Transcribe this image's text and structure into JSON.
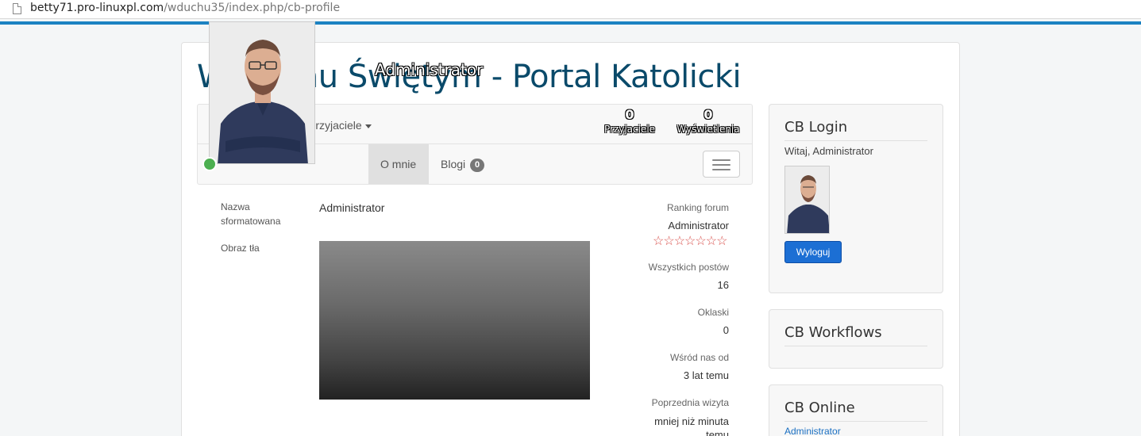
{
  "browser": {
    "url_host": "betty71.pro-linuxpl.com",
    "url_path": "/wduchu35/index.php/cb-profile"
  },
  "site": {
    "title": "W Duchu Świętym - Portal Katolicki"
  },
  "profile": {
    "display_name_overlay": "Administrator",
    "friends_menu_label": "Przyjaciele",
    "stats": {
      "friends_count": "0",
      "friends_label": "Przyjaciele",
      "views_count": "0",
      "views_label": "Wyświetlenia"
    },
    "tabs": [
      {
        "label": "O mnie"
      },
      {
        "label": "Blogi",
        "badge": "0"
      }
    ],
    "online": true
  },
  "details": {
    "formatted_name_label": "Nazwa sformatowana",
    "formatted_name_value": "Administrator",
    "background_label": "Obraz tła"
  },
  "forum": {
    "ranking_label": "Ranking forum",
    "ranking_value": "Administrator",
    "stars": "☆☆☆☆☆☆☆",
    "posts_label": "Wszystkich postów",
    "posts_value": "16",
    "applause_label": "Oklaski",
    "applause_value": "0",
    "member_since_label": "Wśród nas od",
    "member_since_value": "3 lat temu",
    "last_visit_label": "Poprzednia wizyta",
    "last_visit_value": "mniej niż minuta temu"
  },
  "sidebar": {
    "login": {
      "title": "CB Login",
      "welcome": "Witaj, Administrator",
      "logout_label": "Wyloguj"
    },
    "workflows": {
      "title": "CB Workflows"
    },
    "online": {
      "title": "CB Online",
      "users": [
        "Administrator"
      ]
    }
  },
  "colors": {
    "accent": "#1b82c2",
    "title": "#0a4a6a",
    "online": "#4caf50",
    "stars": "#d9534f",
    "button": "#1c6fd4"
  }
}
